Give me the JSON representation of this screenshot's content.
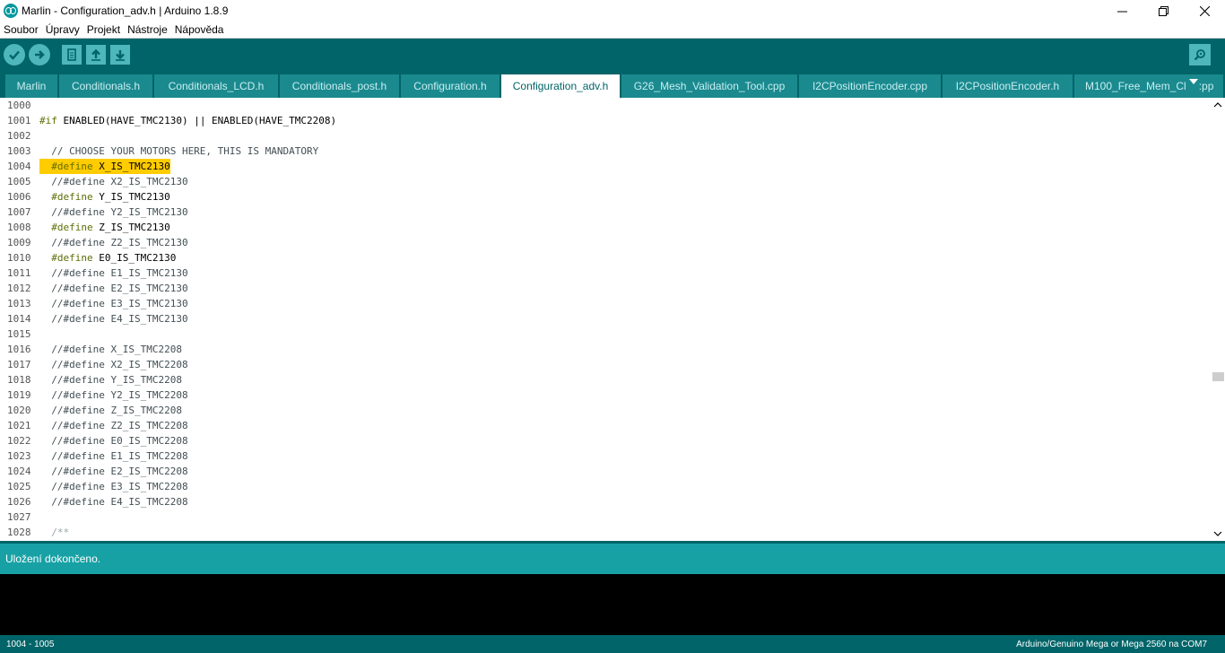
{
  "window": {
    "title": "Marlin - Configuration_adv.h | Arduino 1.8.9",
    "icon": "arduino-logo-icon",
    "controls": [
      "minimize-icon",
      "maximize-icon",
      "close-icon"
    ]
  },
  "menu": {
    "items": [
      "Soubor",
      "Úpravy",
      "Projekt",
      "Nástroje",
      "Nápověda"
    ]
  },
  "toolbar": {
    "verify_icon": "check-icon",
    "upload_icon": "arrow-right-icon",
    "new_icon": "new-file-icon",
    "open_icon": "arrow-up-icon",
    "save_icon": "arrow-down-icon",
    "serial_icon": "magnifier-icon"
  },
  "tabs": {
    "active_index": 5,
    "items": [
      "Marlin",
      "Conditionals.h",
      "Conditionals_LCD.h",
      "Conditionals_post.h",
      "Configuration.h",
      "Configuration_adv.h",
      "G26_Mesh_Validation_Tool.cpp",
      "I2CPositionEncoder.cpp",
      "I2CPositionEncoder.h",
      "M100_Free_Mem_Cl"
    ],
    "overflow_tail": ":pp",
    "overflow_icon": "caret-down-icon"
  },
  "editor": {
    "highlight_line": "1004",
    "lines": [
      {
        "num": "1000",
        "pre": "",
        "text": ""
      },
      {
        "num": "1001",
        "pre": "#if",
        "text": " ENABLED(HAVE_TMC2130) || ENABLED(HAVE_TMC2208)"
      },
      {
        "num": "1002",
        "pre": "",
        "text": ""
      },
      {
        "num": "1003",
        "pre": "",
        "text": "  // CHOOSE YOUR MOTORS HERE, THIS IS MANDATORY"
      },
      {
        "num": "1004",
        "pre": "  #define",
        "text": " X_IS_TMC2130"
      },
      {
        "num": "1005",
        "pre": "",
        "text": "  //#define X2_IS_TMC2130"
      },
      {
        "num": "1006",
        "pre": "  #define",
        "text": " Y_IS_TMC2130"
      },
      {
        "num": "1007",
        "pre": "",
        "text": "  //#define Y2_IS_TMC2130"
      },
      {
        "num": "1008",
        "pre": "  #define",
        "text": " Z_IS_TMC2130"
      },
      {
        "num": "1009",
        "pre": "",
        "text": "  //#define Z2_IS_TMC2130"
      },
      {
        "num": "1010",
        "pre": "  #define",
        "text": " E0_IS_TMC2130"
      },
      {
        "num": "1011",
        "pre": "",
        "text": "  //#define E1_IS_TMC2130"
      },
      {
        "num": "1012",
        "pre": "",
        "text": "  //#define E2_IS_TMC2130"
      },
      {
        "num": "1013",
        "pre": "",
        "text": "  //#define E3_IS_TMC2130"
      },
      {
        "num": "1014",
        "pre": "",
        "text": "  //#define E4_IS_TMC2130"
      },
      {
        "num": "1015",
        "pre": "",
        "text": ""
      },
      {
        "num": "1016",
        "pre": "",
        "text": "  //#define X_IS_TMC2208"
      },
      {
        "num": "1017",
        "pre": "",
        "text": "  //#define X2_IS_TMC2208"
      },
      {
        "num": "1018",
        "pre": "",
        "text": "  //#define Y_IS_TMC2208"
      },
      {
        "num": "1019",
        "pre": "",
        "text": "  //#define Y2_IS_TMC2208"
      },
      {
        "num": "1020",
        "pre": "",
        "text": "  //#define Z_IS_TMC2208"
      },
      {
        "num": "1021",
        "pre": "",
        "text": "  //#define Z2_IS_TMC2208"
      },
      {
        "num": "1022",
        "pre": "",
        "text": "  //#define E0_IS_TMC2208"
      },
      {
        "num": "1023",
        "pre": "",
        "text": "  //#define E1_IS_TMC2208"
      },
      {
        "num": "1024",
        "pre": "",
        "text": "  //#define E2_IS_TMC2208"
      },
      {
        "num": "1025",
        "pre": "",
        "text": "  //#define E3_IS_TMC2208"
      },
      {
        "num": "1026",
        "pre": "",
        "text": "  //#define E4_IS_TMC2208"
      },
      {
        "num": "1027",
        "pre": "",
        "text": ""
      },
      {
        "num": "1028",
        "pre": "",
        "text": "  /**"
      }
    ]
  },
  "status": {
    "message": "Uložení dokončeno."
  },
  "footer": {
    "line_range": "1004 - 1005",
    "board": "Arduino/Genuino Mega or Mega 2560 na COM7"
  },
  "colors": {
    "teal_dark": "#006468",
    "teal_status": "#17a1a5",
    "highlight": "#ffcc00"
  }
}
